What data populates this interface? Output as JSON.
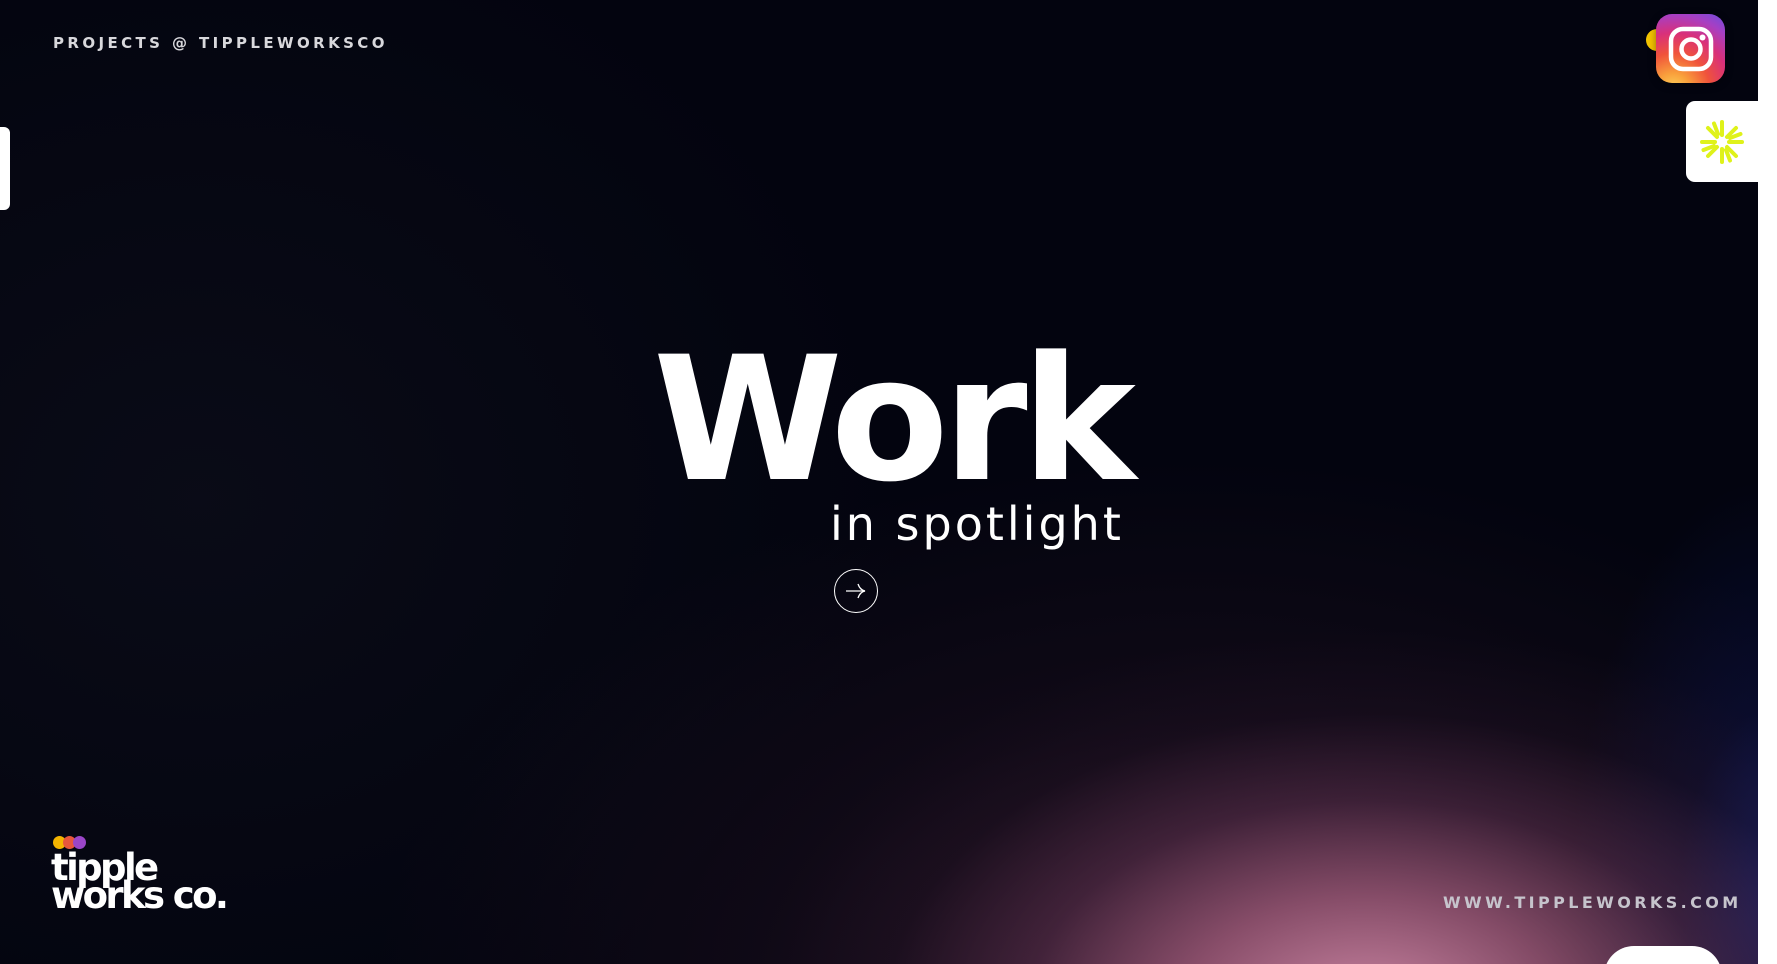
{
  "header": {
    "label": "PROJECTS @ TIPPLEWORKSCO"
  },
  "hero": {
    "title": "Work",
    "subtitle": "in spotlight"
  },
  "logo": {
    "line1": "tipple",
    "line2": "works co.",
    "dot_colors": [
      "#f4b400",
      "#e8563c",
      "#9b46c8"
    ]
  },
  "footer": {
    "url": "WWW.TIPPLEWORKS.COM"
  },
  "icons": {
    "social": "instagram-icon",
    "widget": "asterisk-spark-icon",
    "cta": "arrow-right-icon"
  },
  "colors": {
    "background": "#03040f",
    "spark_yellow": "#dff21a",
    "text": "#ffffff",
    "muted_text": "#d8d8dc"
  }
}
